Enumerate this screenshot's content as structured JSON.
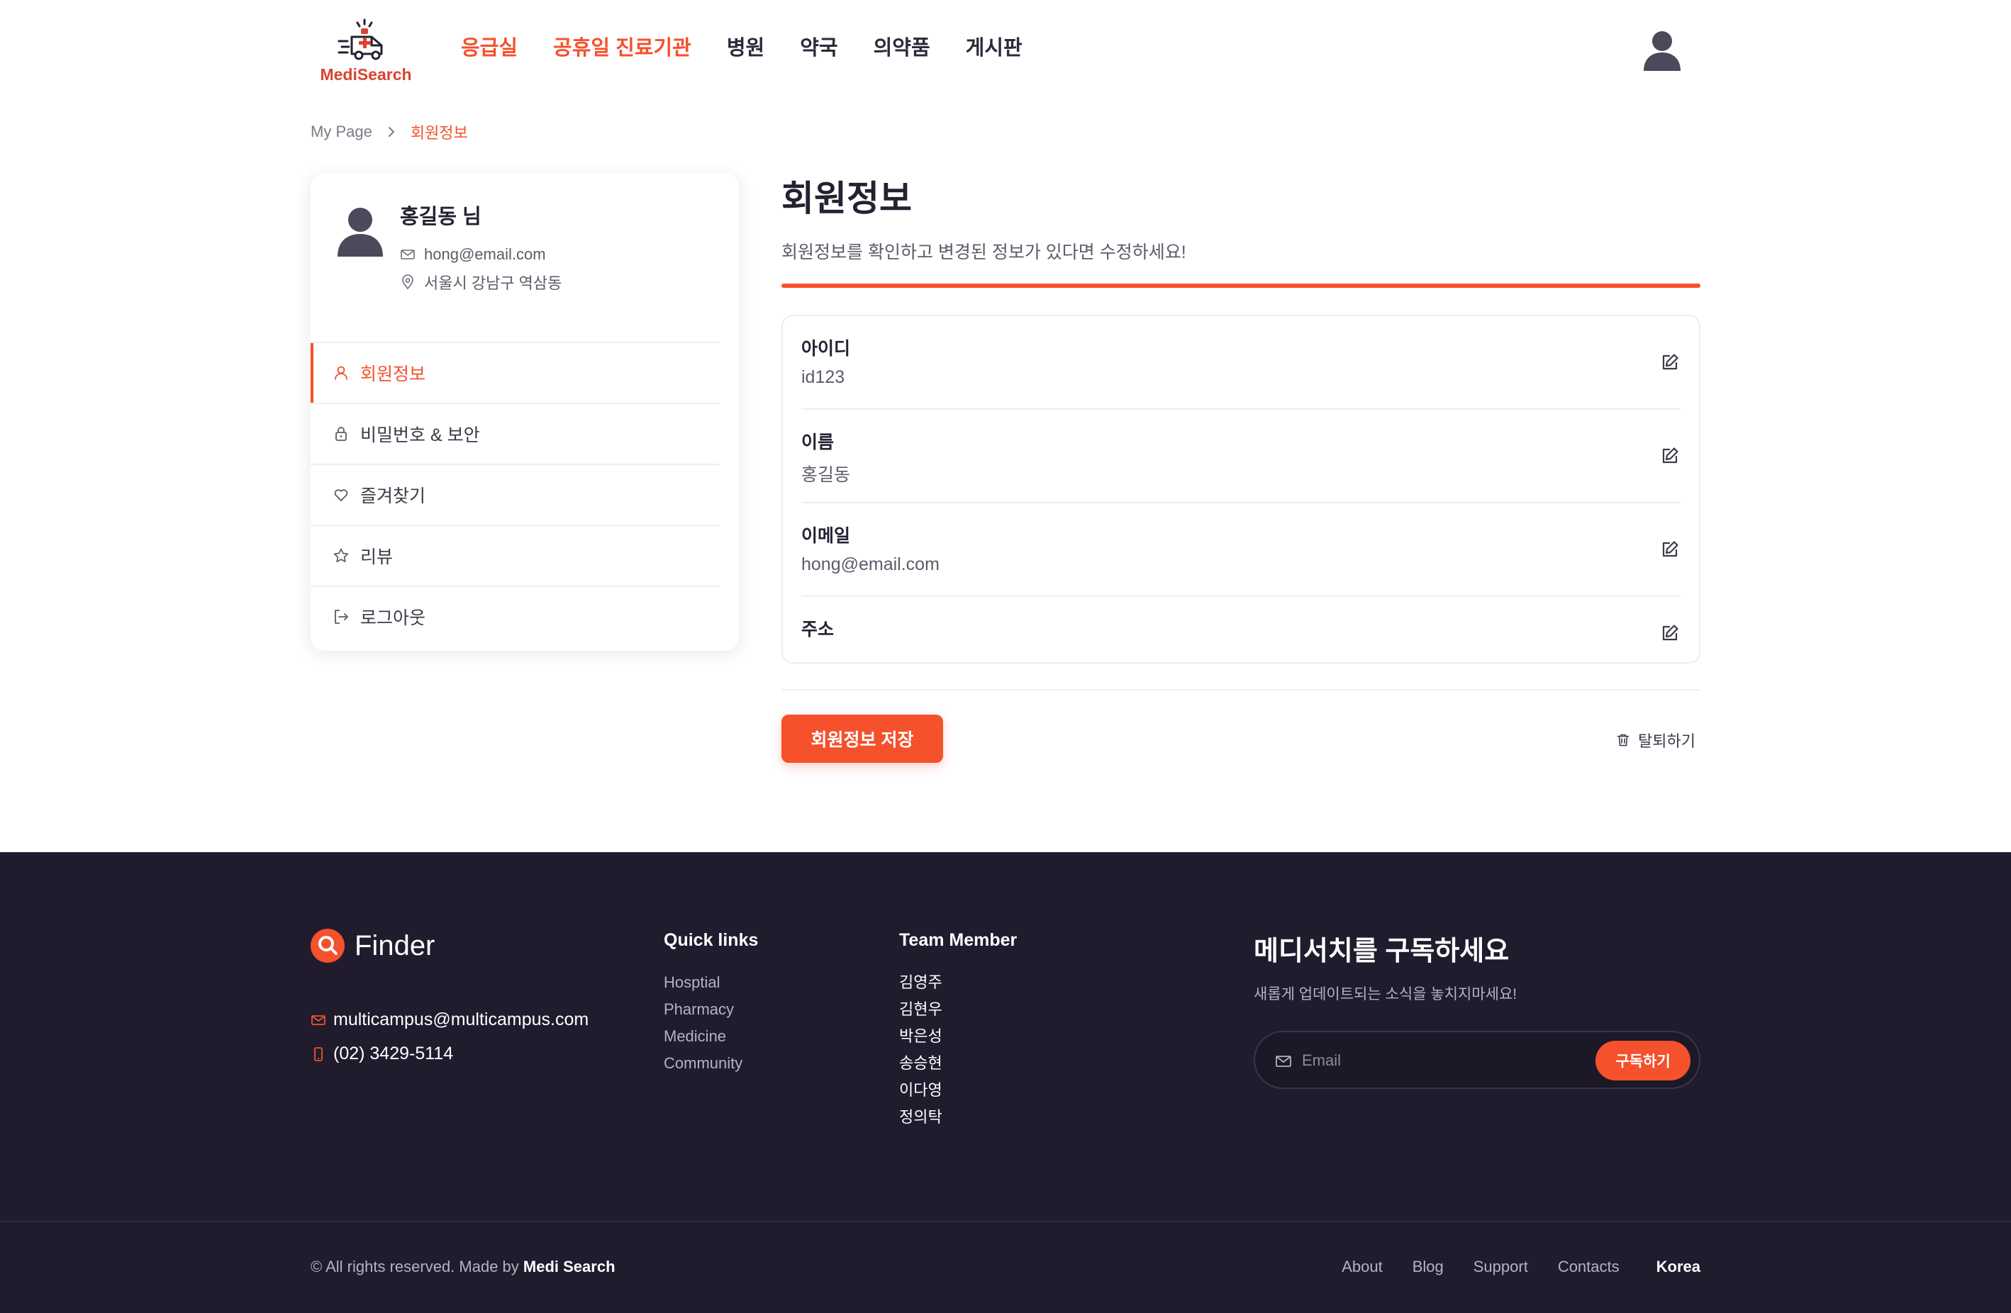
{
  "brand": {
    "name": "MediSearch",
    "accent": "#f4512c"
  },
  "nav": {
    "items": [
      {
        "label": "응급실",
        "active": true
      },
      {
        "label": "공휴일 진료기관",
        "active": true
      },
      {
        "label": "병원",
        "active": false
      },
      {
        "label": "약국",
        "active": false
      },
      {
        "label": "의약품",
        "active": false
      },
      {
        "label": "게시판",
        "active": false
      }
    ]
  },
  "breadcrumb": {
    "parent": "My Page",
    "current": "회원정보"
  },
  "profile": {
    "name": "홍길동 님",
    "email": "hong@email.com",
    "address": "서울시 강남구 역삼동"
  },
  "side_menu": [
    {
      "label": "회원정보",
      "icon": "user-icon"
    },
    {
      "label": "비밀번호 & 보안",
      "icon": "lock-icon"
    },
    {
      "label": "즐겨찾기",
      "icon": "heart-icon"
    },
    {
      "label": "리뷰",
      "icon": "star-icon"
    },
    {
      "label": "로그아웃",
      "icon": "logout-icon"
    }
  ],
  "main": {
    "title": "회원정보",
    "description": "회원정보를 확인하고 변경된 정보가 있다면 수정하세요!",
    "fields": [
      {
        "label": "아이디",
        "value": "id123"
      },
      {
        "label": "이름",
        "value": "홍길동"
      },
      {
        "label": "이메일",
        "value": "hong@email.com"
      },
      {
        "label": "주소",
        "value": ""
      }
    ],
    "save_label": "회원정보 저장",
    "withdraw_label": "탈퇴하기"
  },
  "footer": {
    "logo_text": "Finder",
    "email": "multicampus@multicampus.com",
    "phone": "(02) 3429-5114",
    "quick_links": {
      "title": "Quick links",
      "items": [
        "Hosptial",
        "Pharmacy",
        "Medicine",
        "Community"
      ]
    },
    "team": {
      "title": "Team Member",
      "items": [
        "김영주",
        "김현우",
        "박은성",
        "송승현",
        "이다영",
        "정의탁"
      ]
    },
    "subscribe": {
      "title": "메디서치를 구독하세요",
      "description": "새롭게 업데이트되는 소식을 놓치지마세요!",
      "placeholder": "Email",
      "button_label": "구독하기"
    },
    "copyright_prefix": "© All rights reserved. Made by",
    "copyright_brand": "Medi Search",
    "bottom_links": [
      "About",
      "Blog",
      "Support",
      "Contacts"
    ],
    "language": "Korea",
    "background": "#201c2e"
  }
}
